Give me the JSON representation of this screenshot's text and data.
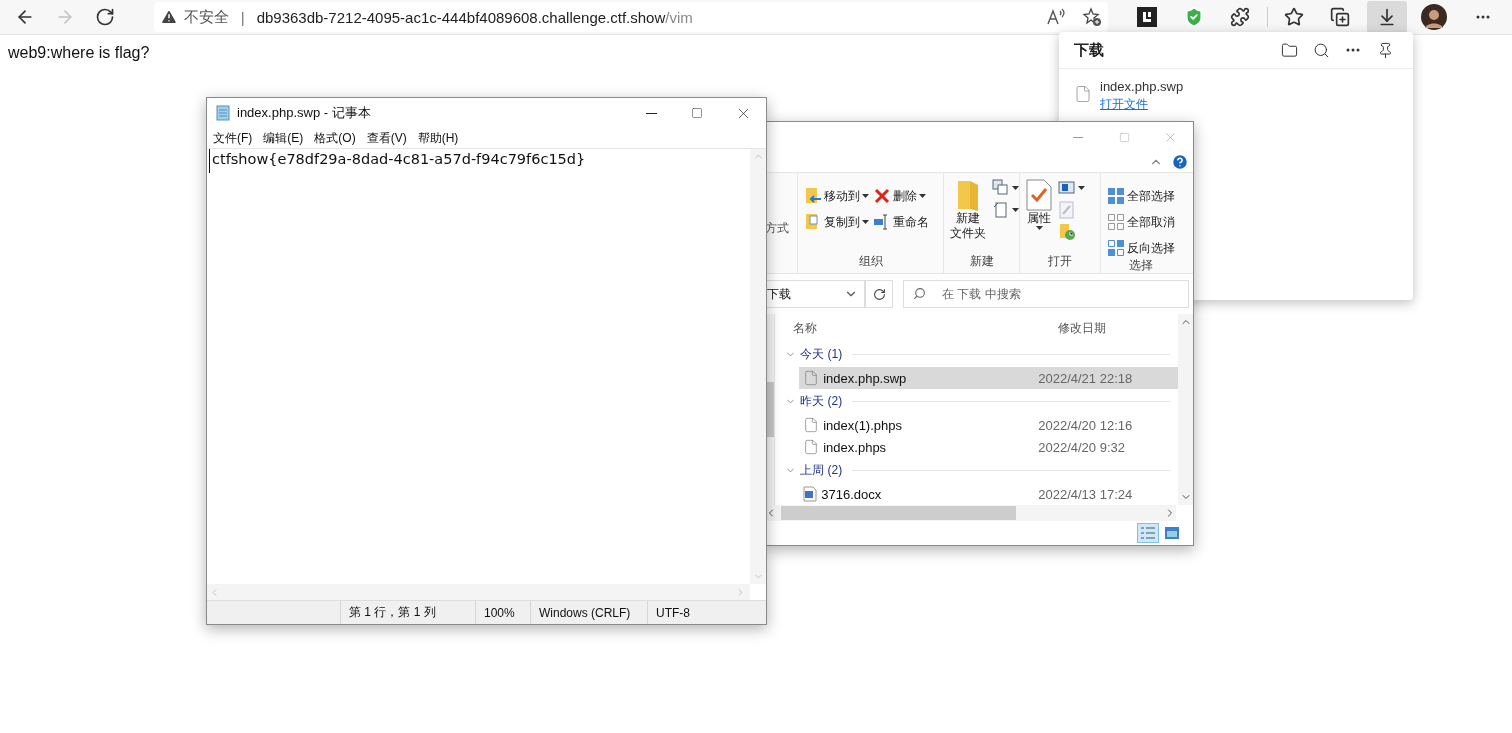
{
  "browser": {
    "nav": [
      {
        "kind": "back",
        "disabled": false
      },
      {
        "kind": "forward",
        "disabled": true
      },
      {
        "kind": "refresh",
        "disabled": false
      }
    ],
    "address": {
      "security": "不安全",
      "separator": "|",
      "host": "db9363db-7212-4095-ac1c-444bf4089608.challenge.ctf.show",
      "path": "/vim",
      "actions": [
        {
          "kind": "read-aloud"
        },
        {
          "kind": "add-favorite"
        }
      ]
    },
    "toolbar": [
      {
        "kind": "extension",
        "selected": false
      },
      {
        "kind": "shield",
        "selected": false
      },
      {
        "kind": "puzzle",
        "selected": false
      },
      {
        "kind": "divider"
      },
      {
        "kind": "favorites",
        "selected": false
      },
      {
        "kind": "collections",
        "selected": false
      },
      {
        "kind": "downloads",
        "selected": true
      },
      {
        "kind": "profile",
        "selected": false
      },
      {
        "kind": "more",
        "selected": false
      }
    ]
  },
  "page": {
    "text": "web9:where is flag?"
  },
  "downloads_panel": {
    "title": "下载",
    "items": [
      {
        "name": "index.php.swp",
        "action": "打开文件"
      }
    ]
  },
  "explorer": {
    "ribbon": {
      "fragment": "方式",
      "groups": [
        {
          "label": "组织",
          "commands": [
            {
              "kind": "move",
              "label": "移动到",
              "dropdown": true
            },
            {
              "kind": "delete",
              "label": "删除",
              "dropdown": true
            },
            {
              "kind": "copy",
              "label": "复制到",
              "dropdown": true
            },
            {
              "kind": "rename",
              "label": "重命名",
              "dropdown": false
            }
          ]
        },
        {
          "label": "新建",
          "commands": [
            {
              "kind": "new-folder",
              "lines": [
                "新建",
                "文件夹"
              ],
              "dropdown": false
            },
            {
              "kind": "new-item",
              "dropdown": true
            },
            {
              "kind": "easy-access",
              "dropdown": true
            }
          ]
        },
        {
          "label": "打开",
          "commands": [
            {
              "kind": "properties",
              "lines": [
                "属性"
              ],
              "dropdown": true
            },
            {
              "kind": "open",
              "dropdown": true
            },
            {
              "kind": "edit",
              "dropdown": false
            },
            {
              "kind": "history",
              "dropdown": false
            }
          ]
        },
        {
          "label": "选择",
          "commands": [
            {
              "kind": "select-all",
              "label": "全部选择",
              "dropdown": false
            },
            {
              "kind": "select-none",
              "label": "全部取消",
              "dropdown": false
            },
            {
              "kind": "invert",
              "label": "反向选择",
              "dropdown": false
            }
          ]
        }
      ]
    },
    "location": "下载",
    "search": {
      "placeholder": "在 下载 中搜索"
    },
    "columns": [
      "名称",
      "修改日期"
    ],
    "groups": [
      {
        "label": "今天 (1)",
        "expanded": true,
        "files": [
          {
            "kind": "file",
            "name": "index.php.swp",
            "date": "2022/4/21 22:18",
            "selected": true
          }
        ]
      },
      {
        "label": "昨天 (2)",
        "expanded": true,
        "files": [
          {
            "kind": "file",
            "name": "index(1).phps",
            "date": "2022/4/20 12:16",
            "selected": false
          },
          {
            "kind": "file",
            "name": "index.phps",
            "date": "2022/4/20 9:32",
            "selected": false
          }
        ]
      },
      {
        "label": "上周 (2)",
        "expanded": true,
        "files": [
          {
            "kind": "docx",
            "name": "3716.docx",
            "date": "2022/4/13 17:24",
            "selected": false
          }
        ]
      }
    ],
    "views": [
      {
        "kind": "details",
        "selected": true
      },
      {
        "kind": "tiles",
        "selected": false
      }
    ]
  },
  "notepad": {
    "title": "index.php.swp - 记事本",
    "menu": [
      "文件(F)",
      "编辑(E)",
      "格式(O)",
      "查看(V)",
      "帮助(H)"
    ],
    "content": "ctfshow{e78df29a-8dad-4c81-a57d-f94c79f6c15d}",
    "status": [
      "第 1 行，第 1 列",
      "100%",
      "Windows (CRLF)",
      "UTF-8"
    ]
  }
}
